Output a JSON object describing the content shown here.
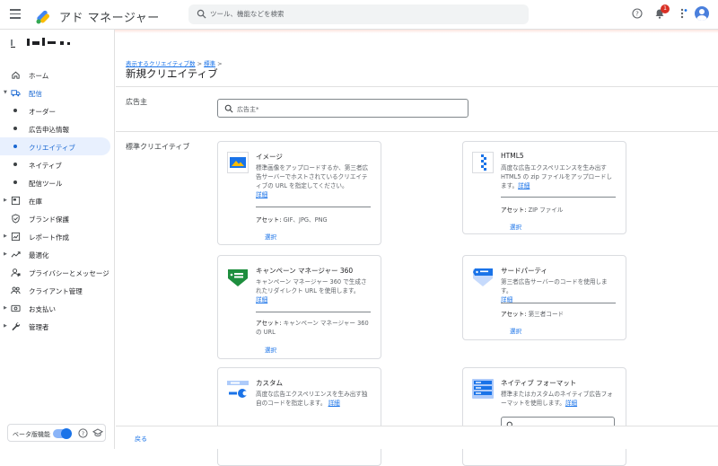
{
  "app": {
    "name": "アド マネージャー"
  },
  "search": {
    "placeholder": "ツール、機能などを検索"
  },
  "notifications": {
    "count": "1"
  },
  "sidebar": {
    "items": [
      {
        "label": "ホーム"
      },
      {
        "label": "配信"
      },
      {
        "label": "オーダー"
      },
      {
        "label": "広告申込情報"
      },
      {
        "label": "クリエイティブ"
      },
      {
        "label": "ネイティブ"
      },
      {
        "label": "配信ツール"
      },
      {
        "label": "在庫"
      },
      {
        "label": "ブランド保護"
      },
      {
        "label": "レポート作成"
      },
      {
        "label": "最適化"
      },
      {
        "label": "プライバシーとメッセージ"
      },
      {
        "label": "クライアント管理"
      },
      {
        "label": "お支払い"
      },
      {
        "label": "管理者"
      }
    ],
    "beta_label": "ベータ版機能"
  },
  "breadcrumb": {
    "item1": "表示するクリエイティブ数",
    "sep": ">",
    "item2": "標準"
  },
  "page": {
    "title": "新規クリエイティブ"
  },
  "advertiser": {
    "label": "広告主",
    "placeholder": "広告主*"
  },
  "standard": {
    "label": "標準クリエイティブ"
  },
  "cards": {
    "image": {
      "title": "イメージ",
      "desc": "標準画像をアップロードするか、第三者広告サーバーでホストされているクリエイティブの URL を指定してください。",
      "link": "詳細",
      "asset_label": "アセット:",
      "asset_value": " GIF、JPG、PNG",
      "select": "選択"
    },
    "html5": {
      "title": "HTML5",
      "desc": "高度な広告エクスペリエンスを生み出す HTML5 の zip ファイルをアップロードします。",
      "link": "詳細",
      "asset_label": "アセット:",
      "asset_value": " ZIP ファイル",
      "select": "選択"
    },
    "campaign": {
      "title": "キャンペーン マネージャー 360",
      "desc": "キャンペーン マネージャー 360 で生成されたリダイレクト URL を使用します。",
      "link": "詳細",
      "asset_label": "アセット:",
      "asset_value": " キャンペーン マネージャー 360 の URL",
      "select": "選択"
    },
    "thirdparty": {
      "title": "サードパーティ",
      "desc": "第三者広告サーバーのコードを使用します。",
      "link": "詳細",
      "asset_label": "アセット:",
      "asset_value": " 第三者コード",
      "select": "選択"
    },
    "custom": {
      "title": "カスタム",
      "desc": "高度な広告エクスペリエンスを生み出す独自のコードを指定します。",
      "link": "詳細"
    },
    "native": {
      "title": "ネイティブ フォーマット",
      "desc": "標準またはカスタムのネイティブ広告フォーマットを使用します。",
      "link": "詳細"
    }
  },
  "footer": {
    "back": "戻る"
  },
  "colors": {
    "accent": "#1a73e8",
    "nav_active_bg": "#e8f0fe",
    "badge": "#d93025"
  }
}
